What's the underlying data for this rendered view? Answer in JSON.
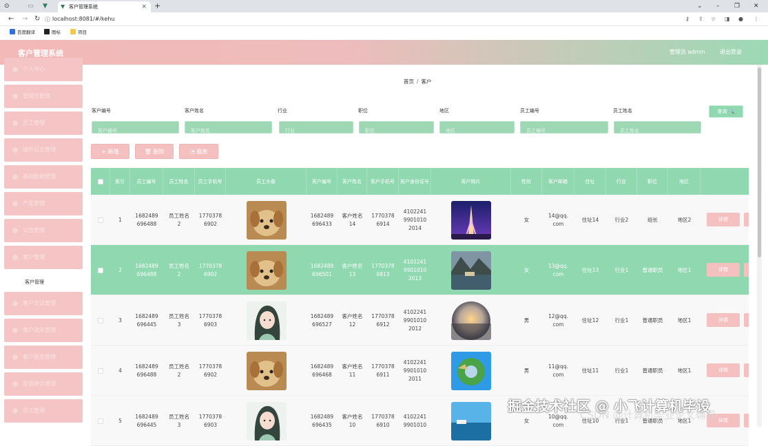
{
  "browser": {
    "tab_title": "客户管理系统",
    "url": "localhost:8081/#/kehu",
    "bookmarks": [
      "百度翻译",
      "图标",
      "项目"
    ]
  },
  "header": {
    "title": "客户管理系统",
    "user": "管理员 admin",
    "logout": "退出登录"
  },
  "sidebar": {
    "items": [
      {
        "label": "个人中心"
      },
      {
        "label": "管理员管理"
      },
      {
        "label": "员工管理"
      },
      {
        "label": "操作日志管理"
      },
      {
        "label": "基础数据管理"
      },
      {
        "label": "产品管理"
      },
      {
        "label": "公告管理"
      },
      {
        "label": "客户管理"
      },
      {
        "label": "客户管理"
      },
      {
        "label": "客户走访管理"
      },
      {
        "label": "客户流失管理"
      },
      {
        "label": "客户服务管理"
      },
      {
        "label": "反馈建议管理"
      },
      {
        "label": "员工管理"
      }
    ]
  },
  "breadcrumb": {
    "home": "首页",
    "sep": "/",
    "current": "客户"
  },
  "filters": {
    "labels": [
      "客户编号",
      "客户姓名",
      "行业",
      "职位",
      "地区",
      "员工编号",
      "员工姓名"
    ],
    "placeholders": [
      "客户编号",
      "客户姓名",
      "行业",
      "职位",
      "地区",
      "员工编号",
      "员工姓名"
    ],
    "search_label": "查询 🔍"
  },
  "actions": {
    "add": "+ 新增",
    "delete": "🗑 删除",
    "report": "◔ 报表"
  },
  "table": {
    "columns": [
      "",
      "索引",
      "员工编号",
      "员工姓名",
      "员工手机号",
      "员工头像",
      "客户编号",
      "客户姓名",
      "客户手机号",
      "客户身份证号",
      "客户照片",
      "性别",
      "客户邮箱",
      "住址",
      "行业",
      "职位",
      "地区",
      ""
    ],
    "detail_label": "详情",
    "rows": [
      {
        "idx": "1",
        "emp_no": "1682489\n696488",
        "emp_name": "员工姓名\n2",
        "emp_phone": "1770378\n6902",
        "avatar": "dog",
        "cust_no": "1682489\n696433",
        "cust_name": "客户姓名\n14",
        "cust_phone": "1770378\n6914",
        "id_card": "4102241\n9901010\n2014",
        "photo": "eiffel",
        "gender": "女",
        "email": "14@qq.\ncom",
        "address": "住址14",
        "industry": "行业2",
        "position": "组长",
        "region": "地区2"
      },
      {
        "idx": "2",
        "emp_no": "1682489\n696488",
        "emp_name": "员工姓名\n2",
        "emp_phone": "1770378\n6902",
        "avatar": "dog",
        "cust_no": "1682489\n696501",
        "cust_name": "客户姓名\n13",
        "cust_phone": "1770378\n6913",
        "id_card": "4102241\n9901010\n2013",
        "photo": "lake",
        "gender": "女",
        "email": "13@qq.\ncom",
        "address": "住址13",
        "industry": "行业1",
        "position": "普通职员",
        "region": "地区1"
      },
      {
        "idx": "3",
        "emp_no": "1682489\n696445",
        "emp_name": "员工姓名\n3",
        "emp_phone": "1770378\n6903",
        "avatar": "girl",
        "cust_no": "1682489\n696527",
        "cust_name": "客户姓名\n12",
        "cust_phone": "1770378\n6912",
        "id_card": "4102241\n9901010\n2012",
        "photo": "sunset",
        "gender": "男",
        "email": "12@qq.\ncom",
        "address": "住址12",
        "industry": "行业1",
        "position": "普通职员",
        "region": "地区1"
      },
      {
        "idx": "4",
        "emp_no": "1682489\n696488",
        "emp_name": "员工姓名\n2",
        "emp_phone": "1770378\n6902",
        "avatar": "dog",
        "cust_no": "1682489\n696468",
        "cust_name": "客户姓名\n11",
        "cust_phone": "1770378\n6911",
        "id_card": "4102241\n9901010\n2011",
        "photo": "planet",
        "gender": "男",
        "email": "11@qq.\ncom",
        "address": "住址11",
        "industry": "行业1",
        "position": "普通职员",
        "region": "地区1"
      },
      {
        "idx": "5",
        "emp_no": "1682489\n696445",
        "emp_name": "员工姓名\n3",
        "emp_phone": "1770378\n6903",
        "avatar": "girl",
        "cust_no": "1682489\n696435",
        "cust_name": "客户姓名\n10",
        "cust_phone": "1770378\n6910",
        "id_card": "4102241\n9901010",
        "photo": "coast",
        "gender": "女",
        "email": "10@qq.\ncom",
        "address": "住址10",
        "industry": "行业1",
        "position": "普通职员",
        "region": "地区1"
      }
    ]
  },
  "watermark": "掘金技术社区 @ 小飞计算机毕设",
  "watermark2": "CSDN @计算机毕业论文辅导",
  "colors": {
    "accent_green": "#8fd8b0",
    "accent_pink": "#f5c0c0"
  }
}
